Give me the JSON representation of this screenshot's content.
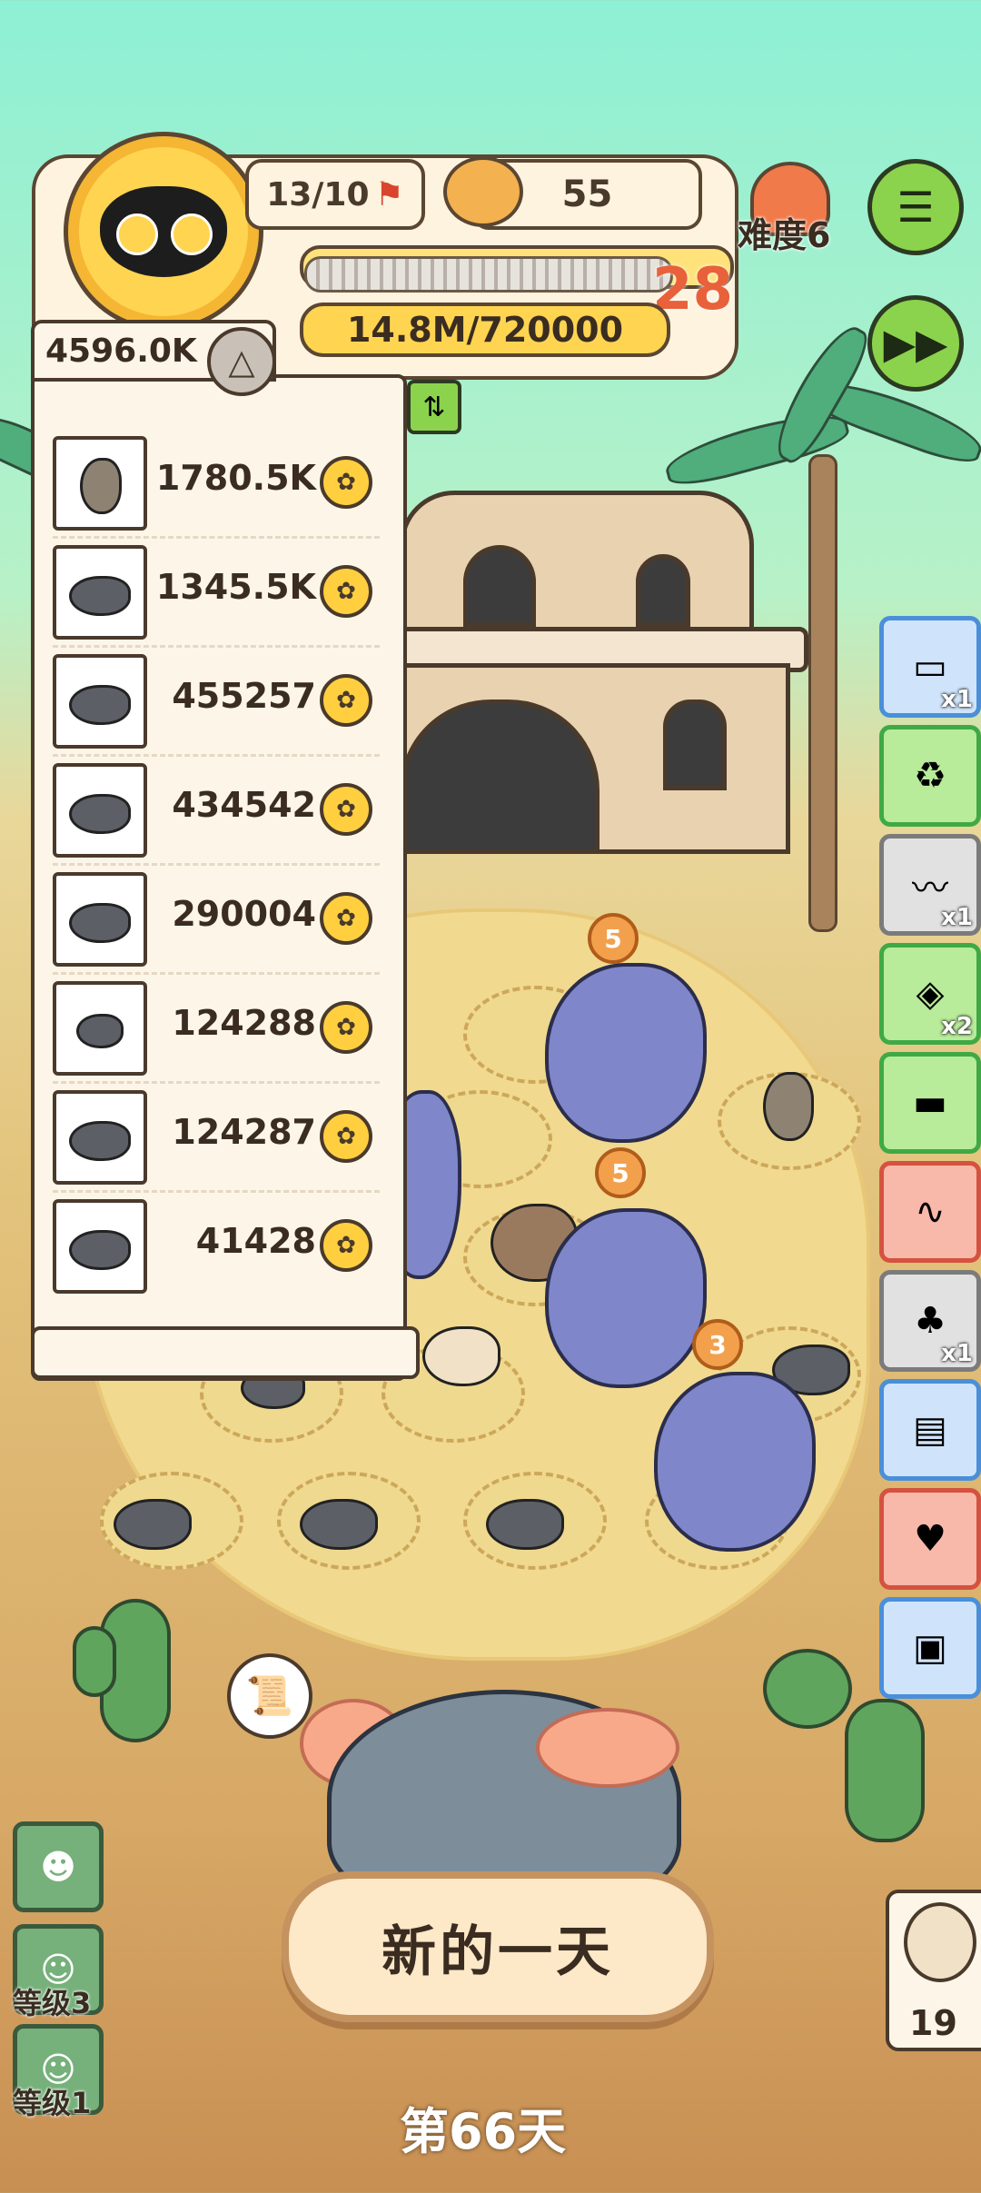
{
  "header": {
    "capacity": "13/10",
    "food_count": "55",
    "difficulty_label": "难度6",
    "level": "28",
    "money_progress": "14.8M/720000"
  },
  "colors": {
    "accent_green": "#8bd34c",
    "gold": "#ffd451",
    "level_orange": "#e8613a"
  },
  "rank_panel": {
    "total": "4596.0K",
    "rows": [
      {
        "value": "1780.5K",
        "icon": "jerboa-icon"
      },
      {
        "value": "1345.5K",
        "icon": "mouse-icon"
      },
      {
        "value": "455257",
        "icon": "mouse-icon"
      },
      {
        "value": "434542",
        "icon": "mouse-icon"
      },
      {
        "value": "290004",
        "icon": "mouse-icon"
      },
      {
        "value": "124288",
        "icon": "small-mouse-icon"
      },
      {
        "value": "124287",
        "icon": "mouse-icon"
      },
      {
        "value": "41428",
        "icon": "mouse-icon"
      }
    ]
  },
  "items": [
    {
      "qty": "x1",
      "icon": "vehicle-icon"
    },
    {
      "qty": "",
      "icon": "ticket-icon"
    },
    {
      "qty": "x1",
      "icon": "worm-icon"
    },
    {
      "qty": "x2",
      "icon": "candy-icon"
    },
    {
      "qty": "",
      "icon": "card-icon"
    },
    {
      "qty": "",
      "icon": "snake-icon"
    },
    {
      "qty": "x1",
      "icon": "mushroom-icon"
    },
    {
      "qty": "",
      "icon": "fire-card-icon"
    },
    {
      "qty": "",
      "icon": "potion-icon"
    },
    {
      "qty": "",
      "icon": "chest-icon"
    }
  ],
  "field_badges": [
    "5",
    "5",
    "3"
  ],
  "bottom": {
    "new_day": "新的一天",
    "day": "第66天",
    "owl_count": "19",
    "skill_levels": [
      "等级3",
      "等级1"
    ]
  }
}
